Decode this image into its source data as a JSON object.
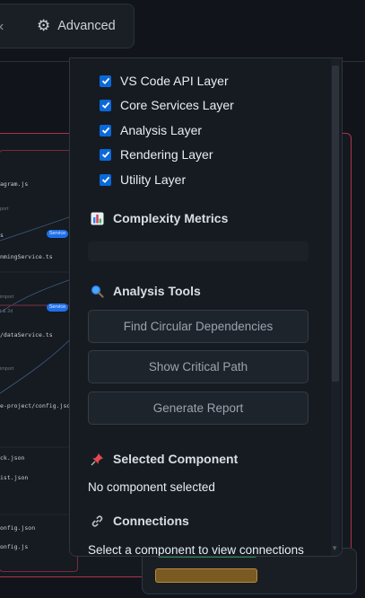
{
  "toolbar": {
    "advanced_label": "Advanced",
    "gear_icon": "gear-icon"
  },
  "background_graph": {
    "nodes": [
      {
        "label": "agram.js"
      },
      {
        "label": "port"
      },
      {
        "label": "s"
      },
      {
        "label": "nmingService.ts"
      },
      {
        "label": "t & 2d"
      },
      {
        "label": "/dataService.ts"
      },
      {
        "label": "e-project/config.json"
      },
      {
        "label": "ck.json"
      },
      {
        "label": "ist.json"
      },
      {
        "label": "onfig.json"
      },
      {
        "label": "onfig.js"
      }
    ],
    "service_badge": "Service",
    "edge_labels": [
      "import",
      "import"
    ]
  },
  "layers": [
    {
      "label": "VS Code API Layer",
      "checked": true
    },
    {
      "label": "Core Services Layer",
      "checked": true
    },
    {
      "label": "Analysis Layer",
      "checked": true
    },
    {
      "label": "Rendering Layer",
      "checked": true
    },
    {
      "label": "Utility Layer",
      "checked": true
    }
  ],
  "sections": {
    "complexity": {
      "title": "Complexity Metrics",
      "icon": "bar-chart-icon"
    },
    "analysis": {
      "title": "Analysis Tools",
      "icon": "magnifier-icon"
    },
    "selected": {
      "title": "Selected Component",
      "icon": "pushpin-icon",
      "value": "No component selected"
    },
    "connections": {
      "title": "Connections",
      "icon": "link-icon",
      "value": "Select a component to view connections"
    }
  },
  "tools": [
    {
      "label": "Find Circular Dependencies"
    },
    {
      "label": "Show Critical Path"
    },
    {
      "label": "Generate Report"
    }
  ],
  "colors": {
    "checkbox": "#0a69da",
    "canvas_border": "#b0324a",
    "service_badge": "#1f6feb"
  }
}
